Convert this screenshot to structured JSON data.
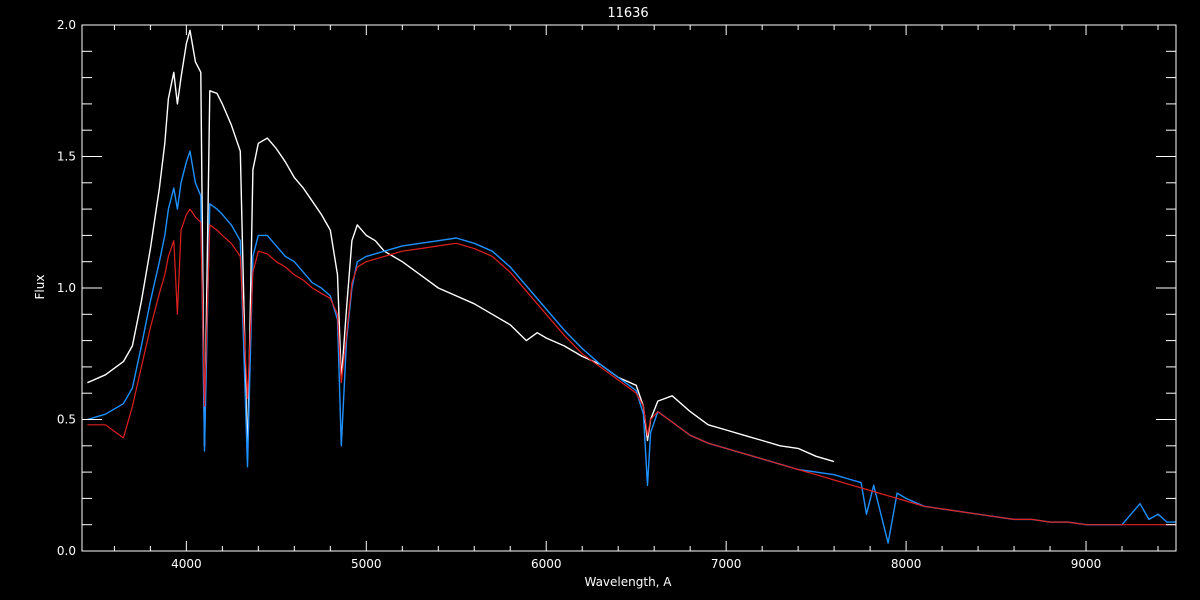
{
  "chart_data": {
    "type": "line",
    "title": "11636",
    "xlabel": "Wavelength, A",
    "ylabel": "Flux",
    "xlim": [
      3420,
      9500
    ],
    "ylim": [
      0,
      2.0
    ],
    "x_ticks": [
      4000,
      5000,
      6000,
      7000,
      8000,
      9000
    ],
    "x_minor_step": 200,
    "y_ticks": [
      0.0,
      0.5,
      1.0,
      1.5,
      2.0
    ],
    "y_tick_labels": [
      "0.0",
      "0.5",
      "1.0",
      "1.5",
      "2.0"
    ],
    "y_minor_step": 0.1,
    "grid": false,
    "colors": {
      "background": "#000000",
      "axes": "#ffffff",
      "observed": "#ffffff",
      "fit": "#1e90ff",
      "model": "#e02020"
    },
    "series": [
      {
        "key": "observed",
        "x": [
          3450,
          3550,
          3650,
          3700,
          3750,
          3800,
          3850,
          3880,
          3900,
          3930,
          3950,
          3970,
          4000,
          4020,
          4050,
          4080,
          4101,
          4130,
          4170,
          4200,
          4250,
          4300,
          4340,
          4370,
          4400,
          4450,
          4500,
          4550,
          4600,
          4650,
          4700,
          4750,
          4800,
          4840,
          4861,
          4890,
          4920,
          4950,
          5000,
          5050,
          5100,
          5200,
          5300,
          5400,
          5500,
          5600,
          5700,
          5800,
          5890,
          5950,
          6000,
          6100,
          6200,
          6300,
          6400,
          6500,
          6540,
          6563,
          6580,
          6620,
          6700,
          6800,
          6900,
          7000,
          7100,
          7200,
          7300,
          7400,
          7500,
          7600
        ],
        "y": [
          0.64,
          0.67,
          0.72,
          0.78,
          0.95,
          1.15,
          1.38,
          1.55,
          1.72,
          1.82,
          1.7,
          1.8,
          1.93,
          1.98,
          1.86,
          1.82,
          0.4,
          1.75,
          1.74,
          1.7,
          1.62,
          1.52,
          0.35,
          1.45,
          1.55,
          1.57,
          1.53,
          1.48,
          1.42,
          1.38,
          1.33,
          1.28,
          1.22,
          1.05,
          0.65,
          0.92,
          1.18,
          1.24,
          1.2,
          1.18,
          1.14,
          1.1,
          1.05,
          1.0,
          0.97,
          0.94,
          0.9,
          0.86,
          0.8,
          0.83,
          0.81,
          0.78,
          0.74,
          0.71,
          0.66,
          0.63,
          0.55,
          0.42,
          0.5,
          0.57,
          0.59,
          0.53,
          0.48,
          0.46,
          0.44,
          0.42,
          0.4,
          0.39,
          0.36,
          0.34
        ]
      },
      {
        "key": "fit",
        "x": [
          3450,
          3550,
          3650,
          3700,
          3750,
          3800,
          3850,
          3880,
          3900,
          3930,
          3950,
          3970,
          4000,
          4020,
          4050,
          4080,
          4101,
          4130,
          4170,
          4200,
          4250,
          4300,
          4340,
          4370,
          4400,
          4450,
          4500,
          4550,
          4600,
          4650,
          4700,
          4750,
          4800,
          4840,
          4861,
          4890,
          4920,
          4950,
          5000,
          5100,
          5200,
          5300,
          5400,
          5500,
          5600,
          5700,
          5800,
          5900,
          6000,
          6100,
          6200,
          6300,
          6400,
          6500,
          6540,
          6563,
          6580,
          6620,
          6700,
          6800,
          6900,
          7000,
          7100,
          7200,
          7300,
          7400,
          7500,
          7600,
          7700,
          7750,
          7780,
          7820,
          7900,
          7950,
          8000,
          8100,
          8200,
          8300,
          8400,
          8500,
          8600,
          8700,
          8800,
          8900,
          9000,
          9100,
          9200,
          9250,
          9300,
          9350,
          9400,
          9450,
          9500
        ],
        "y": [
          0.5,
          0.52,
          0.56,
          0.62,
          0.78,
          0.95,
          1.1,
          1.2,
          1.3,
          1.38,
          1.3,
          1.4,
          1.48,
          1.52,
          1.4,
          1.35,
          0.38,
          1.32,
          1.3,
          1.28,
          1.24,
          1.18,
          0.32,
          1.12,
          1.2,
          1.2,
          1.16,
          1.12,
          1.1,
          1.06,
          1.02,
          1.0,
          0.97,
          0.88,
          0.4,
          0.8,
          1.0,
          1.1,
          1.12,
          1.14,
          1.16,
          1.17,
          1.18,
          1.19,
          1.17,
          1.14,
          1.08,
          1.0,
          0.92,
          0.84,
          0.77,
          0.71,
          0.66,
          0.61,
          0.52,
          0.25,
          0.45,
          0.53,
          0.49,
          0.44,
          0.41,
          0.39,
          0.37,
          0.35,
          0.33,
          0.31,
          0.3,
          0.29,
          0.27,
          0.26,
          0.14,
          0.25,
          0.03,
          0.22,
          0.2,
          0.17,
          0.16,
          0.15,
          0.14,
          0.13,
          0.12,
          0.12,
          0.11,
          0.11,
          0.1,
          0.1,
          0.1,
          0.14,
          0.18,
          0.12,
          0.14,
          0.11,
          0.11
        ]
      },
      {
        "key": "model",
        "x": [
          3450,
          3550,
          3650,
          3700,
          3750,
          3800,
          3850,
          3880,
          3900,
          3930,
          3950,
          3970,
          4000,
          4020,
          4050,
          4080,
          4101,
          4130,
          4170,
          4200,
          4250,
          4300,
          4340,
          4370,
          4400,
          4450,
          4500,
          4550,
          4600,
          4650,
          4700,
          4750,
          4800,
          4840,
          4861,
          4890,
          4920,
          4950,
          5000,
          5100,
          5200,
          5300,
          5400,
          5500,
          5600,
          5700,
          5800,
          5900,
          6000,
          6100,
          6200,
          6300,
          6400,
          6500,
          6540,
          6563,
          6580,
          6620,
          6700,
          6800,
          6900,
          7000,
          7100,
          7200,
          7300,
          7400,
          7500,
          7600,
          7700,
          7800,
          7900,
          8000,
          8100,
          8200,
          8300,
          8400,
          8500,
          8600,
          8700,
          8800,
          8900,
          9000,
          9100,
          9200,
          9300,
          9400,
          9500
        ],
        "y": [
          0.48,
          0.48,
          0.43,
          0.55,
          0.7,
          0.85,
          0.98,
          1.05,
          1.12,
          1.18,
          0.9,
          1.22,
          1.28,
          1.3,
          1.27,
          1.25,
          0.55,
          1.24,
          1.22,
          1.2,
          1.17,
          1.12,
          0.58,
          1.06,
          1.14,
          1.13,
          1.1,
          1.08,
          1.05,
          1.03,
          1.0,
          0.98,
          0.96,
          0.9,
          0.64,
          0.82,
          1.02,
          1.08,
          1.1,
          1.12,
          1.14,
          1.15,
          1.16,
          1.17,
          1.15,
          1.12,
          1.06,
          0.98,
          0.9,
          0.82,
          0.75,
          0.7,
          0.65,
          0.6,
          0.55,
          0.44,
          0.5,
          0.53,
          0.49,
          0.44,
          0.41,
          0.39,
          0.37,
          0.35,
          0.33,
          0.31,
          0.29,
          0.27,
          0.25,
          0.23,
          0.21,
          0.19,
          0.17,
          0.16,
          0.15,
          0.14,
          0.13,
          0.12,
          0.12,
          0.11,
          0.11,
          0.1,
          0.1,
          0.1,
          0.1,
          0.1,
          0.1
        ]
      }
    ]
  }
}
